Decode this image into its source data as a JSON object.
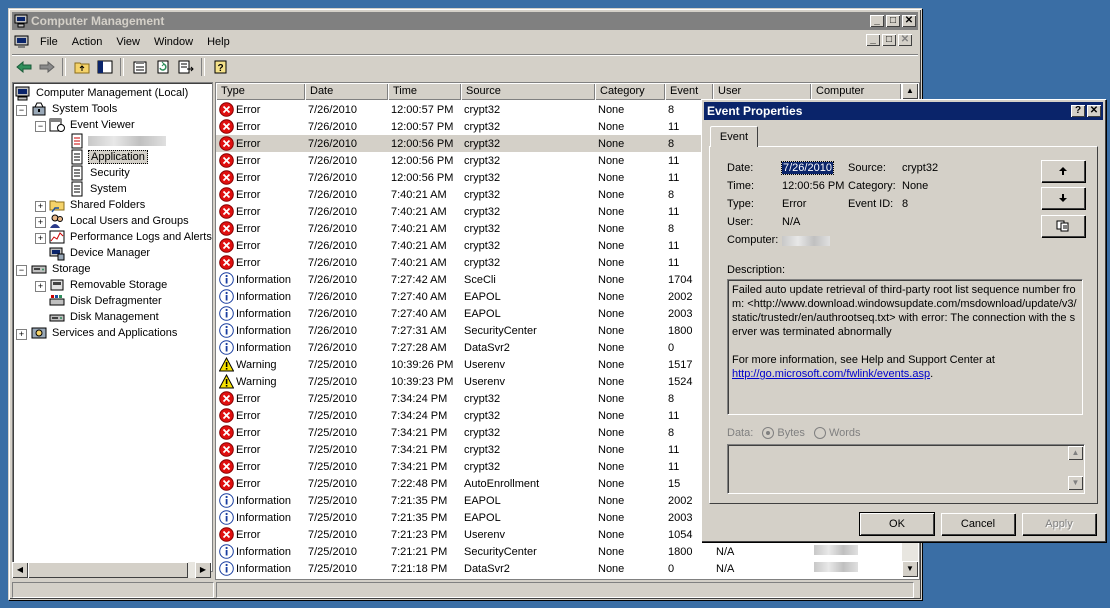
{
  "main_window": {
    "title": "Computer Management",
    "caption_min": "_",
    "caption_max": "□",
    "caption_close": "✕",
    "menu": [
      "File",
      "Action",
      "View",
      "Window",
      "Help"
    ]
  },
  "tree": {
    "root": "Computer Management (Local)",
    "system_tools": "System Tools",
    "event_viewer": "Event Viewer",
    "application": "Application",
    "security": "Security",
    "system": "System",
    "shared_folders": "Shared Folders",
    "local_users": "Local Users and Groups",
    "perf_logs": "Performance Logs and Alerts",
    "device_manager": "Device Manager",
    "storage": "Storage",
    "removable_storage": "Removable Storage",
    "disk_defrag": "Disk Defragmenter",
    "disk_mgmt": "Disk Management",
    "services": "Services and Applications"
  },
  "list": {
    "columns": [
      "Type",
      "Date",
      "Time",
      "Source",
      "Category",
      "Event",
      "User",
      "Computer"
    ],
    "rows": [
      {
        "type": "Error",
        "date": "7/26/2010",
        "time": "12:00:57 PM",
        "source": "crypt32",
        "category": "None",
        "event": "8",
        "user": "",
        "icon": "error-icon"
      },
      {
        "type": "Error",
        "date": "7/26/2010",
        "time": "12:00:57 PM",
        "source": "crypt32",
        "category": "None",
        "event": "11",
        "user": "",
        "icon": "error-icon"
      },
      {
        "type": "Error",
        "date": "7/26/2010",
        "time": "12:00:56 PM",
        "source": "crypt32",
        "category": "None",
        "event": "8",
        "user": "",
        "icon": "error-icon",
        "selected": true
      },
      {
        "type": "Error",
        "date": "7/26/2010",
        "time": "12:00:56 PM",
        "source": "crypt32",
        "category": "None",
        "event": "11",
        "user": "",
        "icon": "error-icon"
      },
      {
        "type": "Error",
        "date": "7/26/2010",
        "time": "12:00:56 PM",
        "source": "crypt32",
        "category": "None",
        "event": "11",
        "user": "",
        "icon": "error-icon"
      },
      {
        "type": "Error",
        "date": "7/26/2010",
        "time": "7:40:21 AM",
        "source": "crypt32",
        "category": "None",
        "event": "8",
        "user": "",
        "icon": "error-icon"
      },
      {
        "type": "Error",
        "date": "7/26/2010",
        "time": "7:40:21 AM",
        "source": "crypt32",
        "category": "None",
        "event": "11",
        "user": "",
        "icon": "error-icon"
      },
      {
        "type": "Error",
        "date": "7/26/2010",
        "time": "7:40:21 AM",
        "source": "crypt32",
        "category": "None",
        "event": "8",
        "user": "",
        "icon": "error-icon"
      },
      {
        "type": "Error",
        "date": "7/26/2010",
        "time": "7:40:21 AM",
        "source": "crypt32",
        "category": "None",
        "event": "11",
        "user": "",
        "icon": "error-icon"
      },
      {
        "type": "Error",
        "date": "7/26/2010",
        "time": "7:40:21 AM",
        "source": "crypt32",
        "category": "None",
        "event": "11",
        "user": "",
        "icon": "error-icon"
      },
      {
        "type": "Information",
        "date": "7/26/2010",
        "time": "7:27:42 AM",
        "source": "SceCli",
        "category": "None",
        "event": "1704",
        "user": "",
        "icon": "info-icon"
      },
      {
        "type": "Information",
        "date": "7/26/2010",
        "time": "7:27:40 AM",
        "source": "EAPOL",
        "category": "None",
        "event": "2002",
        "user": "",
        "icon": "info-icon"
      },
      {
        "type": "Information",
        "date": "7/26/2010",
        "time": "7:27:40 AM",
        "source": "EAPOL",
        "category": "None",
        "event": "2003",
        "user": "",
        "icon": "info-icon"
      },
      {
        "type": "Information",
        "date": "7/26/2010",
        "time": "7:27:31 AM",
        "source": "SecurityCenter",
        "category": "None",
        "event": "1800",
        "user": "",
        "icon": "info-icon"
      },
      {
        "type": "Information",
        "date": "7/26/2010",
        "time": "7:27:28 AM",
        "source": "DataSvr2",
        "category": "None",
        "event": "0",
        "user": "",
        "icon": "info-icon"
      },
      {
        "type": "Warning",
        "date": "7/25/2010",
        "time": "10:39:26 PM",
        "source": "Userenv",
        "category": "None",
        "event": "1517",
        "user": "",
        "icon": "warning-icon"
      },
      {
        "type": "Warning",
        "date": "7/25/2010",
        "time": "10:39:23 PM",
        "source": "Userenv",
        "category": "None",
        "event": "1524",
        "user": "",
        "icon": "warning-icon"
      },
      {
        "type": "Error",
        "date": "7/25/2010",
        "time": "7:34:24 PM",
        "source": "crypt32",
        "category": "None",
        "event": "8",
        "user": "",
        "icon": "error-icon"
      },
      {
        "type": "Error",
        "date": "7/25/2010",
        "time": "7:34:24 PM",
        "source": "crypt32",
        "category": "None",
        "event": "11",
        "user": "",
        "icon": "error-icon"
      },
      {
        "type": "Error",
        "date": "7/25/2010",
        "time": "7:34:21 PM",
        "source": "crypt32",
        "category": "None",
        "event": "8",
        "user": "",
        "icon": "error-icon"
      },
      {
        "type": "Error",
        "date": "7/25/2010",
        "time": "7:34:21 PM",
        "source": "crypt32",
        "category": "None",
        "event": "11",
        "user": "",
        "icon": "error-icon"
      },
      {
        "type": "Error",
        "date": "7/25/2010",
        "time": "7:34:21 PM",
        "source": "crypt32",
        "category": "None",
        "event": "11",
        "user": "",
        "icon": "error-icon"
      },
      {
        "type": "Error",
        "date": "7/25/2010",
        "time": "7:22:48 PM",
        "source": "AutoEnrollment",
        "category": "None",
        "event": "15",
        "user": "",
        "icon": "error-icon"
      },
      {
        "type": "Information",
        "date": "7/25/2010",
        "time": "7:21:35 PM",
        "source": "EAPOL",
        "category": "None",
        "event": "2002",
        "user": "",
        "icon": "info-icon"
      },
      {
        "type": "Information",
        "date": "7/25/2010",
        "time": "7:21:35 PM",
        "source": "EAPOL",
        "category": "None",
        "event": "2003",
        "user": "",
        "icon": "info-icon"
      },
      {
        "type": "Error",
        "date": "7/25/2010",
        "time": "7:21:23 PM",
        "source": "Userenv",
        "category": "None",
        "event": "1054",
        "user": "",
        "icon": "error-icon"
      },
      {
        "type": "Information",
        "date": "7/25/2010",
        "time": "7:21:21 PM",
        "source": "SecurityCenter",
        "category": "None",
        "event": "1800",
        "user": "N/A",
        "icon": "info-icon"
      },
      {
        "type": "Information",
        "date": "7/25/2010",
        "time": "7:21:18 PM",
        "source": "DataSvr2",
        "category": "None",
        "event": "0",
        "user": "N/A",
        "icon": "info-icon"
      }
    ]
  },
  "dialog": {
    "title": "Event Properties",
    "help_btn": "?",
    "close_btn": "✕",
    "tab": "Event",
    "date_label": "Date:",
    "date_value": "7/26/2010",
    "source_label": "Source:",
    "source_value": "crypt32",
    "time_label": "Time:",
    "time_value": "12:00:56 PM",
    "category_label": "Category:",
    "category_value": "None",
    "type_label": "Type:",
    "type_value": "Error",
    "eventid_label": "Event ID:",
    "eventid_value": "8",
    "user_label": "User:",
    "user_value": "N/A",
    "computer_label": "Computer:",
    "description_label": "Description:",
    "description_text": "Failed auto update retrieval of third-party root list sequence number from: <http://www.download.windowsupdate.com/msdownload/update/v3/static/trustedr/en/authrootseq.txt> with error: The connection with the server was terminated abnormally",
    "more_info": "For more information, see Help and Support Center at",
    "more_info_link": "http://go.microsoft.com/fwlink/events.asp",
    "more_info_end": ".",
    "data_label": "Data:",
    "bytes_label": "Bytes",
    "words_label": "Words",
    "ok": "OK",
    "cancel": "Cancel",
    "apply": "Apply"
  },
  "colors": {
    "desktop": "#3a6ea5",
    "active_title": "#0a246a",
    "inactive_title": "#808080",
    "face": "#d4d0c8"
  }
}
